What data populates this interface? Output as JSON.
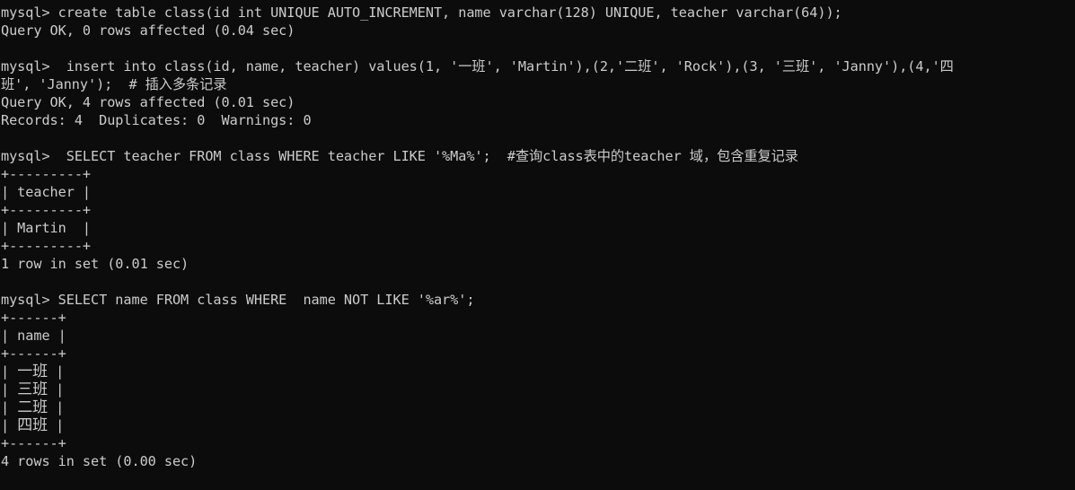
{
  "terminal": {
    "prompt": "mysql>",
    "background_color": "#0c0c0c",
    "text_color": "#cccccc",
    "blocks": {
      "create_table": {
        "command": "mysql> create table class(id int UNIQUE AUTO_INCREMENT, name varchar(128) UNIQUE, teacher varchar(64));",
        "result": "Query OK, 0 rows affected (0.04 sec)"
      },
      "insert": {
        "command_line1": "mysql>  insert into class(id, name, teacher) values(1, '一班', 'Martin'),(2,'二班', 'Rock'),(3, '三班', 'Janny'),(4,'四",
        "command_line2": "班', 'Janny');  # 插入多条记录",
        "result": "Query OK, 4 rows affected (0.01 sec)",
        "records_line": "Records: 4  Duplicates: 0  Warnings: 0"
      },
      "select_teacher": {
        "command": "mysql>  SELECT teacher FROM class WHERE teacher LIKE '%Ma%';  #查询class表中的teacher 域，包含重复记录",
        "table": {
          "border": "+---------+",
          "header": "| teacher |",
          "rows": [
            "| Martin  |"
          ]
        },
        "footer": "1 row in set (0.01 sec)"
      },
      "select_name": {
        "command": "mysql> SELECT name FROM class WHERE  name NOT LIKE '%ar%';",
        "table": {
          "border": "+------+",
          "header": "| name |",
          "rows": [
            {
              "left": "| ",
              "value": "一班",
              "right": " |"
            },
            {
              "left": "| ",
              "value": "三班",
              "right": " |"
            },
            {
              "left": "| ",
              "value": "二班",
              "right": " |"
            },
            {
              "left": "| ",
              "value": "四班",
              "right": " |"
            }
          ]
        },
        "footer": "4 rows in set (0.00 sec)"
      }
    }
  }
}
